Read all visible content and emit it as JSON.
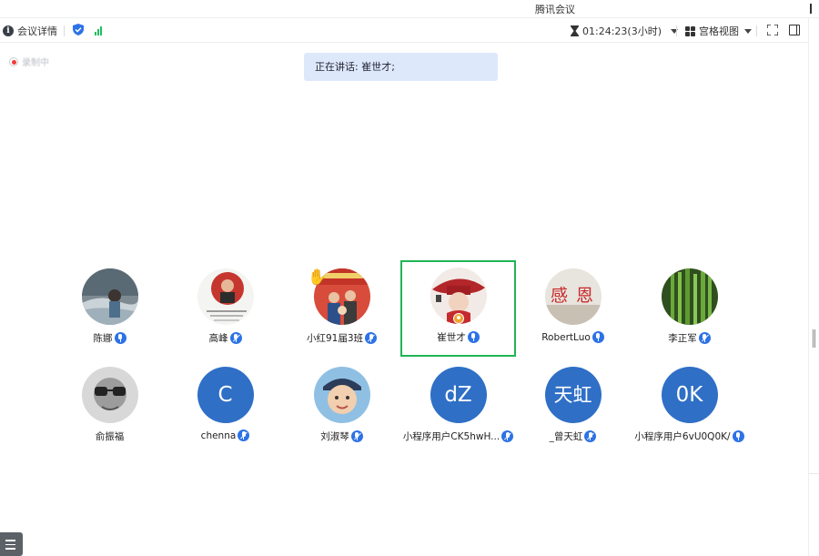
{
  "window": {
    "title": "腾讯会议"
  },
  "toolbar": {
    "meeting_details": "会议详情",
    "timer": "01:24:23(3小时)",
    "view_mode": "宫格视图"
  },
  "recording": {
    "label": "录制中"
  },
  "speaking": {
    "text": "正在讲话: 崔世才;"
  },
  "colors": {
    "accent": "#2d72e6",
    "active_border": "#22b456",
    "banner_bg": "#dde9fb",
    "initials_avatar": "#2f6fc6"
  },
  "participants": [
    {
      "name": "陈娜",
      "mic": "on"
    },
    {
      "name": "高峰",
      "mic": "off"
    },
    {
      "name": "小红91届3班",
      "mic": "off"
    },
    {
      "name": "崔世才",
      "mic": "on",
      "host": true,
      "active": true
    },
    {
      "name": "RobertLuo",
      "mic": "on"
    },
    {
      "name": "李正军",
      "mic": "off"
    },
    {
      "name": "俞振福",
      "mic": "none"
    },
    {
      "name": "chenna",
      "mic": "off",
      "initials": "C"
    },
    {
      "name": "刘淑琴",
      "mic": "off"
    },
    {
      "name": "小程序用户CK5hwH...",
      "mic": "off",
      "initials": "dZ"
    },
    {
      "name": "_曾天虹",
      "mic": "off",
      "initials": "天虹"
    },
    {
      "name": "小程序用户6vU0Q0K/",
      "mic": "on",
      "initials": "0K"
    }
  ]
}
